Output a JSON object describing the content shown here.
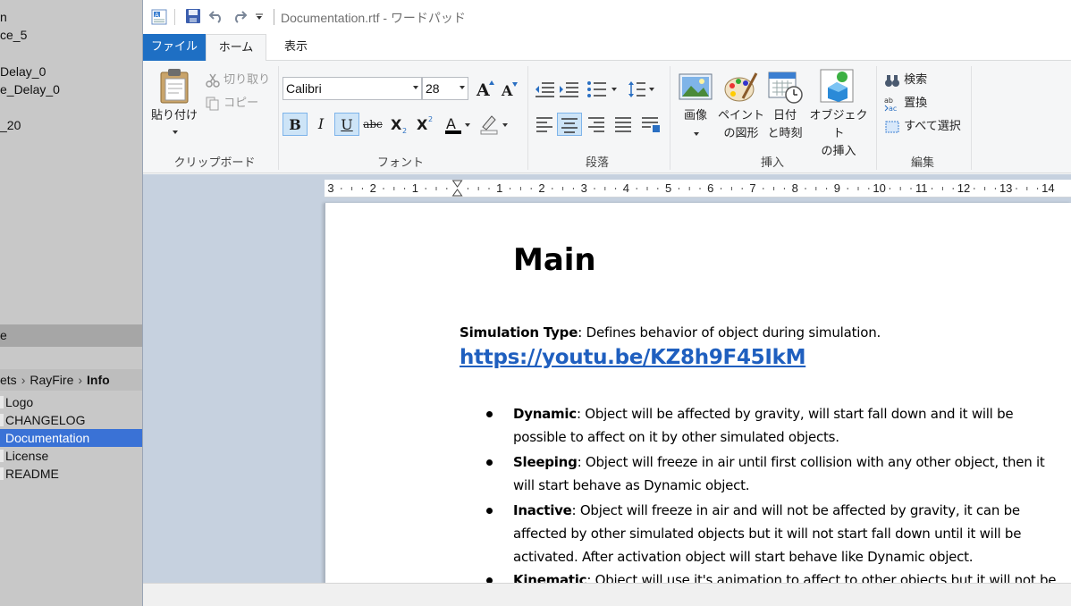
{
  "background_app": {
    "scene_items": [
      "n",
      "ce_5",
      "",
      "Delay_0",
      "e_Delay_0",
      "",
      "_20"
    ],
    "panel_header": "e",
    "breadcrumb": {
      "part1": "ets",
      "part2": "RayFire",
      "part3": "Info"
    },
    "assets": [
      {
        "label": "Logo",
        "selected": false
      },
      {
        "label": "CHANGELOG",
        "selected": false
      },
      {
        "label": "Documentation",
        "selected": true
      },
      {
        "label": "License",
        "selected": false
      },
      {
        "label": "README",
        "selected": false
      }
    ]
  },
  "window": {
    "title": "Documentation.rtf - ワードパッド",
    "tabs": {
      "file": "ファイル",
      "home": "ホーム",
      "view": "表示"
    }
  },
  "ribbon": {
    "clipboard": {
      "paste": "貼り付け",
      "cut": "切り取り",
      "copy": "コピー",
      "label": "クリップボード"
    },
    "font": {
      "family": "Calibri",
      "size": "28",
      "label": "フォント",
      "bold": "B",
      "italic": "I",
      "underline": "U",
      "strike": "abc"
    },
    "paragraph": {
      "label": "段落"
    },
    "insert": {
      "picture": "画像",
      "paint_line1": "ペイント",
      "paint_line2": "の図形",
      "datetime_line1": "日付",
      "datetime_line2": "と時刻",
      "object_line1": "オブジェクト",
      "object_line2": "の挿入",
      "label": "挿入"
    },
    "editing": {
      "find": "検索",
      "replace": "置換",
      "select_all": "すべて選択",
      "label": "編集"
    }
  },
  "ruler": {
    "labels": [
      "3",
      "2",
      "1",
      "",
      "1",
      "2",
      "3",
      "4",
      "5",
      "6",
      "7",
      "8",
      "9",
      "10",
      "11",
      "12",
      "13",
      "14"
    ]
  },
  "document": {
    "heading": "Main",
    "sim_type_label": "Simulation Type",
    "sim_type_text": ": Defines behavior of object during simulation.",
    "link": "https://youtu.be/KZ8h9F45IkM",
    "bullets": [
      {
        "term": "Dynamic",
        "line1": ": Object will be affected by gravity, will start fall down and it will be",
        "line2": "possible to affect on it by other simulated objects.",
        "line3": ""
      },
      {
        "term": "Sleeping",
        "line1": ": Object will freeze in air until first collision with any other object, then it",
        "line2": "will start behave as Dynamic object.",
        "line3": ""
      },
      {
        "term": "Inactive",
        "line1": ": Object will freeze in air and will not be affected by gravity, it can be",
        "line2": "affected by other simulated objects but it will not start fall down until it will be",
        "line3": "activated. After activation object will start behave like Dynamic object."
      },
      {
        "term": "Kinematic",
        "line1": ": Object will use it's animation to affect to other objects but it will not be",
        "line2": "",
        "line3": ""
      }
    ]
  },
  "colors": {
    "accent": "#1e6fc4",
    "selection": "#3a72d6",
    "link": "#1f5fbf"
  }
}
